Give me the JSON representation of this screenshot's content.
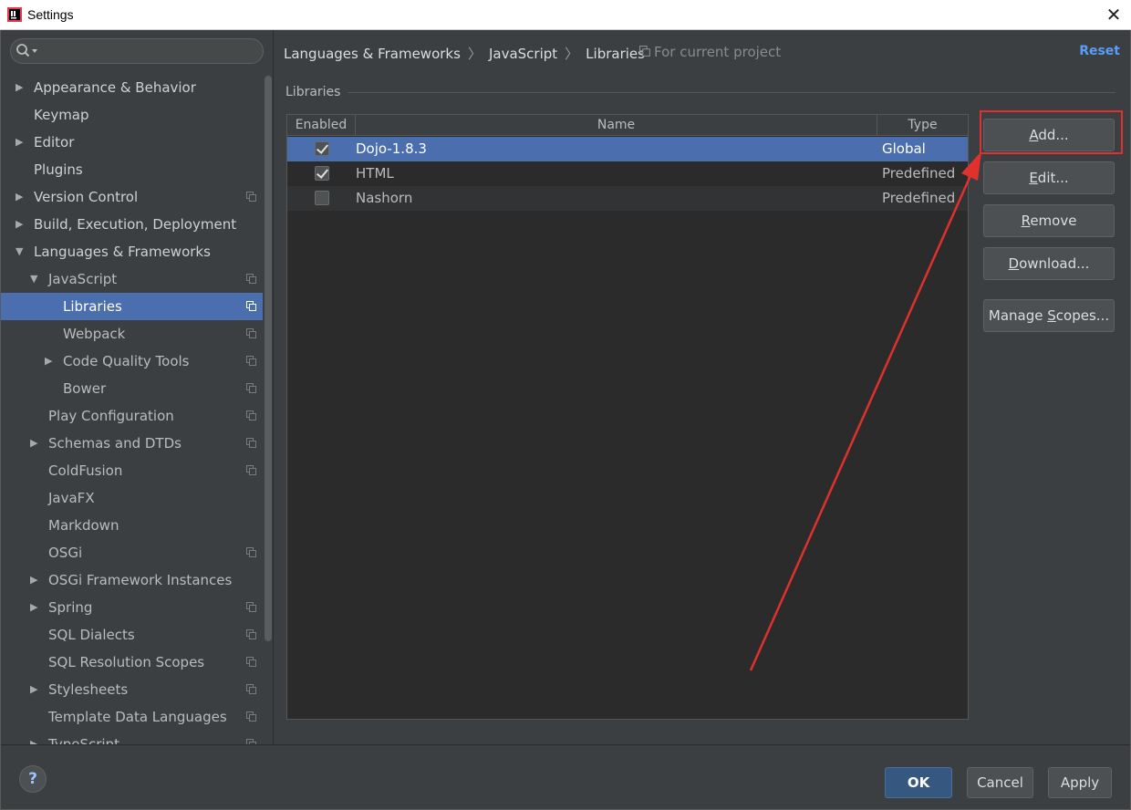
{
  "window": {
    "title": "Settings",
    "close_glyph": "✕"
  },
  "search": {
    "value": "",
    "icon": "search-icon"
  },
  "sidebar": {
    "items": [
      {
        "label": "Appearance & Behavior",
        "expander": "▶",
        "project": false
      },
      {
        "label": "Keymap",
        "expander": "",
        "project": false
      },
      {
        "label": "Editor",
        "expander": "▶",
        "project": false
      },
      {
        "label": "Plugins",
        "expander": "",
        "project": false
      },
      {
        "label": "Version Control",
        "expander": "▶",
        "project": true
      },
      {
        "label": "Build, Execution, Deployment",
        "expander": "▶",
        "project": false
      },
      {
        "label": "Languages & Frameworks",
        "expander": "▼",
        "project": false
      },
      {
        "label": "JavaScript",
        "expander": "▼",
        "project": true
      },
      {
        "label": "Libraries",
        "expander": "",
        "project": true,
        "selected": true
      },
      {
        "label": "Webpack",
        "expander": "",
        "project": true
      },
      {
        "label": "Code Quality Tools",
        "expander": "▶",
        "project": true
      },
      {
        "label": "Bower",
        "expander": "",
        "project": true
      },
      {
        "label": "Play Configuration",
        "expander": "",
        "project": true
      },
      {
        "label": "Schemas and DTDs",
        "expander": "▶",
        "project": true
      },
      {
        "label": "ColdFusion",
        "expander": "",
        "project": true
      },
      {
        "label": "JavaFX",
        "expander": "",
        "project": false
      },
      {
        "label": "Markdown",
        "expander": "",
        "project": false
      },
      {
        "label": "OSGi",
        "expander": "",
        "project": true
      },
      {
        "label": "OSGi Framework Instances",
        "expander": "▶",
        "project": false
      },
      {
        "label": "Spring",
        "expander": "▶",
        "project": true
      },
      {
        "label": "SQL Dialects",
        "expander": "",
        "project": true
      },
      {
        "label": "SQL Resolution Scopes",
        "expander": "",
        "project": true
      },
      {
        "label": "Stylesheets",
        "expander": "▶",
        "project": true
      },
      {
        "label": "Template Data Languages",
        "expander": "",
        "project": true
      },
      {
        "label": "TypeScript",
        "expander": "▶",
        "project": true
      }
    ]
  },
  "breadcrumb": {
    "items": [
      "Languages & Frameworks",
      "JavaScript",
      "Libraries"
    ],
    "separator": "〉",
    "project_note": "For current project"
  },
  "reset_label": "Reset",
  "libraries": {
    "group_title": "Libraries",
    "columns": [
      "Enabled",
      "Name",
      "Type"
    ],
    "rows": [
      {
        "enabled": true,
        "name": "Dojo-1.8.3",
        "type": "Global",
        "selected": true
      },
      {
        "enabled": true,
        "name": "HTML",
        "type": "Predefined"
      },
      {
        "enabled": false,
        "name": "Nashorn",
        "type": "Predefined"
      }
    ]
  },
  "buttons": {
    "add": {
      "pre": "",
      "mnemonic": "A",
      "post": "dd..."
    },
    "edit": {
      "pre": "",
      "mnemonic": "E",
      "post": "dit..."
    },
    "remove": {
      "pre": "",
      "mnemonic": "R",
      "post": "emove"
    },
    "download": {
      "pre": "",
      "mnemonic": "D",
      "post": "ownload..."
    },
    "manage_scopes": {
      "pre": "Manage ",
      "mnemonic": "S",
      "post": "copes..."
    }
  },
  "footer": {
    "help": "?",
    "ok": "OK",
    "cancel": "Cancel",
    "apply": {
      "pre": "",
      "mnemonic": "A",
      "post": "pply"
    }
  },
  "annotation": {
    "highlight_color": "#e0312e"
  }
}
